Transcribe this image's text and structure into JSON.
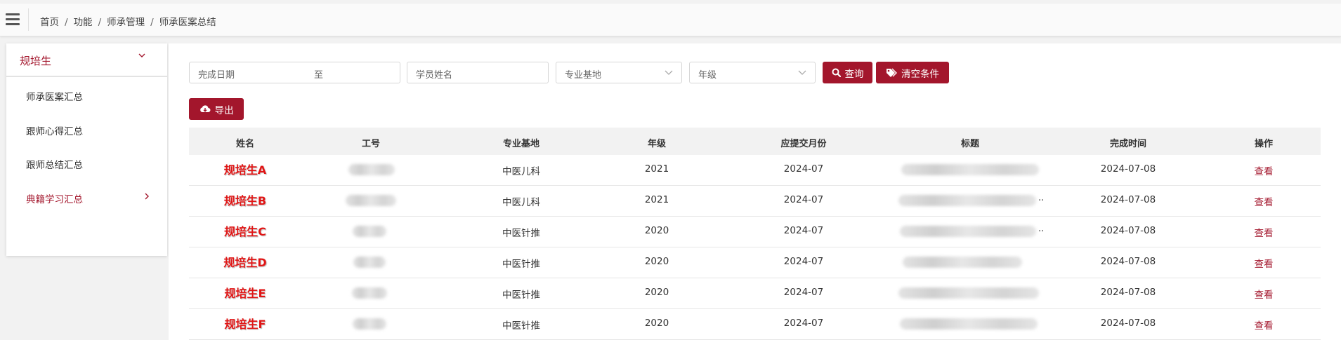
{
  "breadcrumb": {
    "items": [
      "首页",
      "功能",
      "师承管理",
      "师承医案总结"
    ],
    "separator": "/"
  },
  "sidebar": {
    "section_title": "规培生",
    "items": [
      {
        "label": "师承医案汇总"
      },
      {
        "label": "跟师心得汇总"
      },
      {
        "label": "跟师总结汇总"
      },
      {
        "label": "典籍学习汇总",
        "active": true
      }
    ]
  },
  "filters": {
    "date_label": "完成日期",
    "date_to": "至",
    "student_name_placeholder": "学员姓名",
    "base_placeholder": "专业基地",
    "grade_placeholder": "年级",
    "search_label": "查询",
    "clear_label": "清空条件",
    "export_label": "导出"
  },
  "table": {
    "columns": [
      "姓名",
      "工号",
      "专业基地",
      "年级",
      "应提交月份",
      "标题",
      "完成时间",
      "操作"
    ],
    "rows": [
      {
        "name": "规培生A",
        "base": "中医儿科",
        "grade": "2021",
        "month": "2024-07",
        "completed": "2024-07-08",
        "action": "查看"
      },
      {
        "name": "规培生B",
        "base": "中医儿科",
        "grade": "2021",
        "month": "2024-07",
        "completed": "2024-07-08",
        "action": "查看"
      },
      {
        "name": "规培生C",
        "base": "中医针推",
        "grade": "2020",
        "month": "2024-07",
        "completed": "2024-07-08",
        "action": "查看"
      },
      {
        "name": "规培生D",
        "base": "中医针推",
        "grade": "2020",
        "month": "2024-07",
        "completed": "2024-07-08",
        "action": "查看"
      },
      {
        "name": "规培生E",
        "base": "中医针推",
        "grade": "2020",
        "month": "2024-07",
        "completed": "2024-07-08",
        "action": "查看"
      },
      {
        "name": "规培生F",
        "base": "中医针推",
        "grade": "2020",
        "month": "2024-07",
        "completed": "2024-07-08",
        "action": "查看"
      }
    ]
  },
  "colors": {
    "accent": "#a3162c",
    "name_highlight": "#e01515"
  },
  "icons": [
    "menu-icon",
    "chevron-down-icon",
    "chevron-right-icon",
    "search-icon",
    "tag-icon",
    "cloud-download-icon"
  ]
}
